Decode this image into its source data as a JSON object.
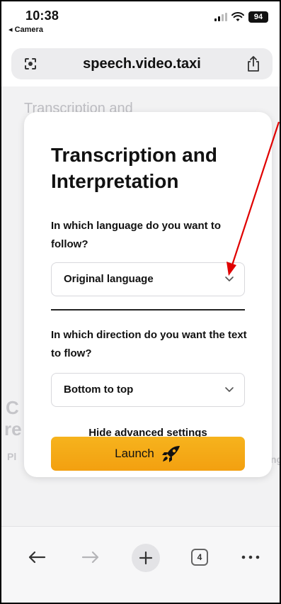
{
  "status_bar": {
    "time": "10:38",
    "back_app": "◂ Camera",
    "battery": "94"
  },
  "address_bar": {
    "url": "speech.video.taxi",
    "left_icon": "page-options-icon",
    "right_icon": "share-icon"
  },
  "background": {
    "title": "Transcription and",
    "fragments": [
      "C",
      "re",
      "Pl",
      "ng"
    ]
  },
  "modal": {
    "title": "Transcription and Interpretation",
    "language_question": "In which language do you want to follow?",
    "language_value": "Original language",
    "direction_question": "In which direction do you want the text to flow?",
    "direction_value": "Bottom to top",
    "advanced_link": "Hide advanced settings",
    "launch_label": "Launch",
    "launch_icon": "rocket-icon"
  },
  "toolbar": {
    "back_icon": "back-arrow-icon",
    "forward_icon": "forward-arrow-icon",
    "new_tab_icon": "plus-icon",
    "tab_count": "4",
    "more_icon": "more-icon"
  },
  "colors": {
    "accent": "#f5a816",
    "annotation": "#e00000"
  }
}
